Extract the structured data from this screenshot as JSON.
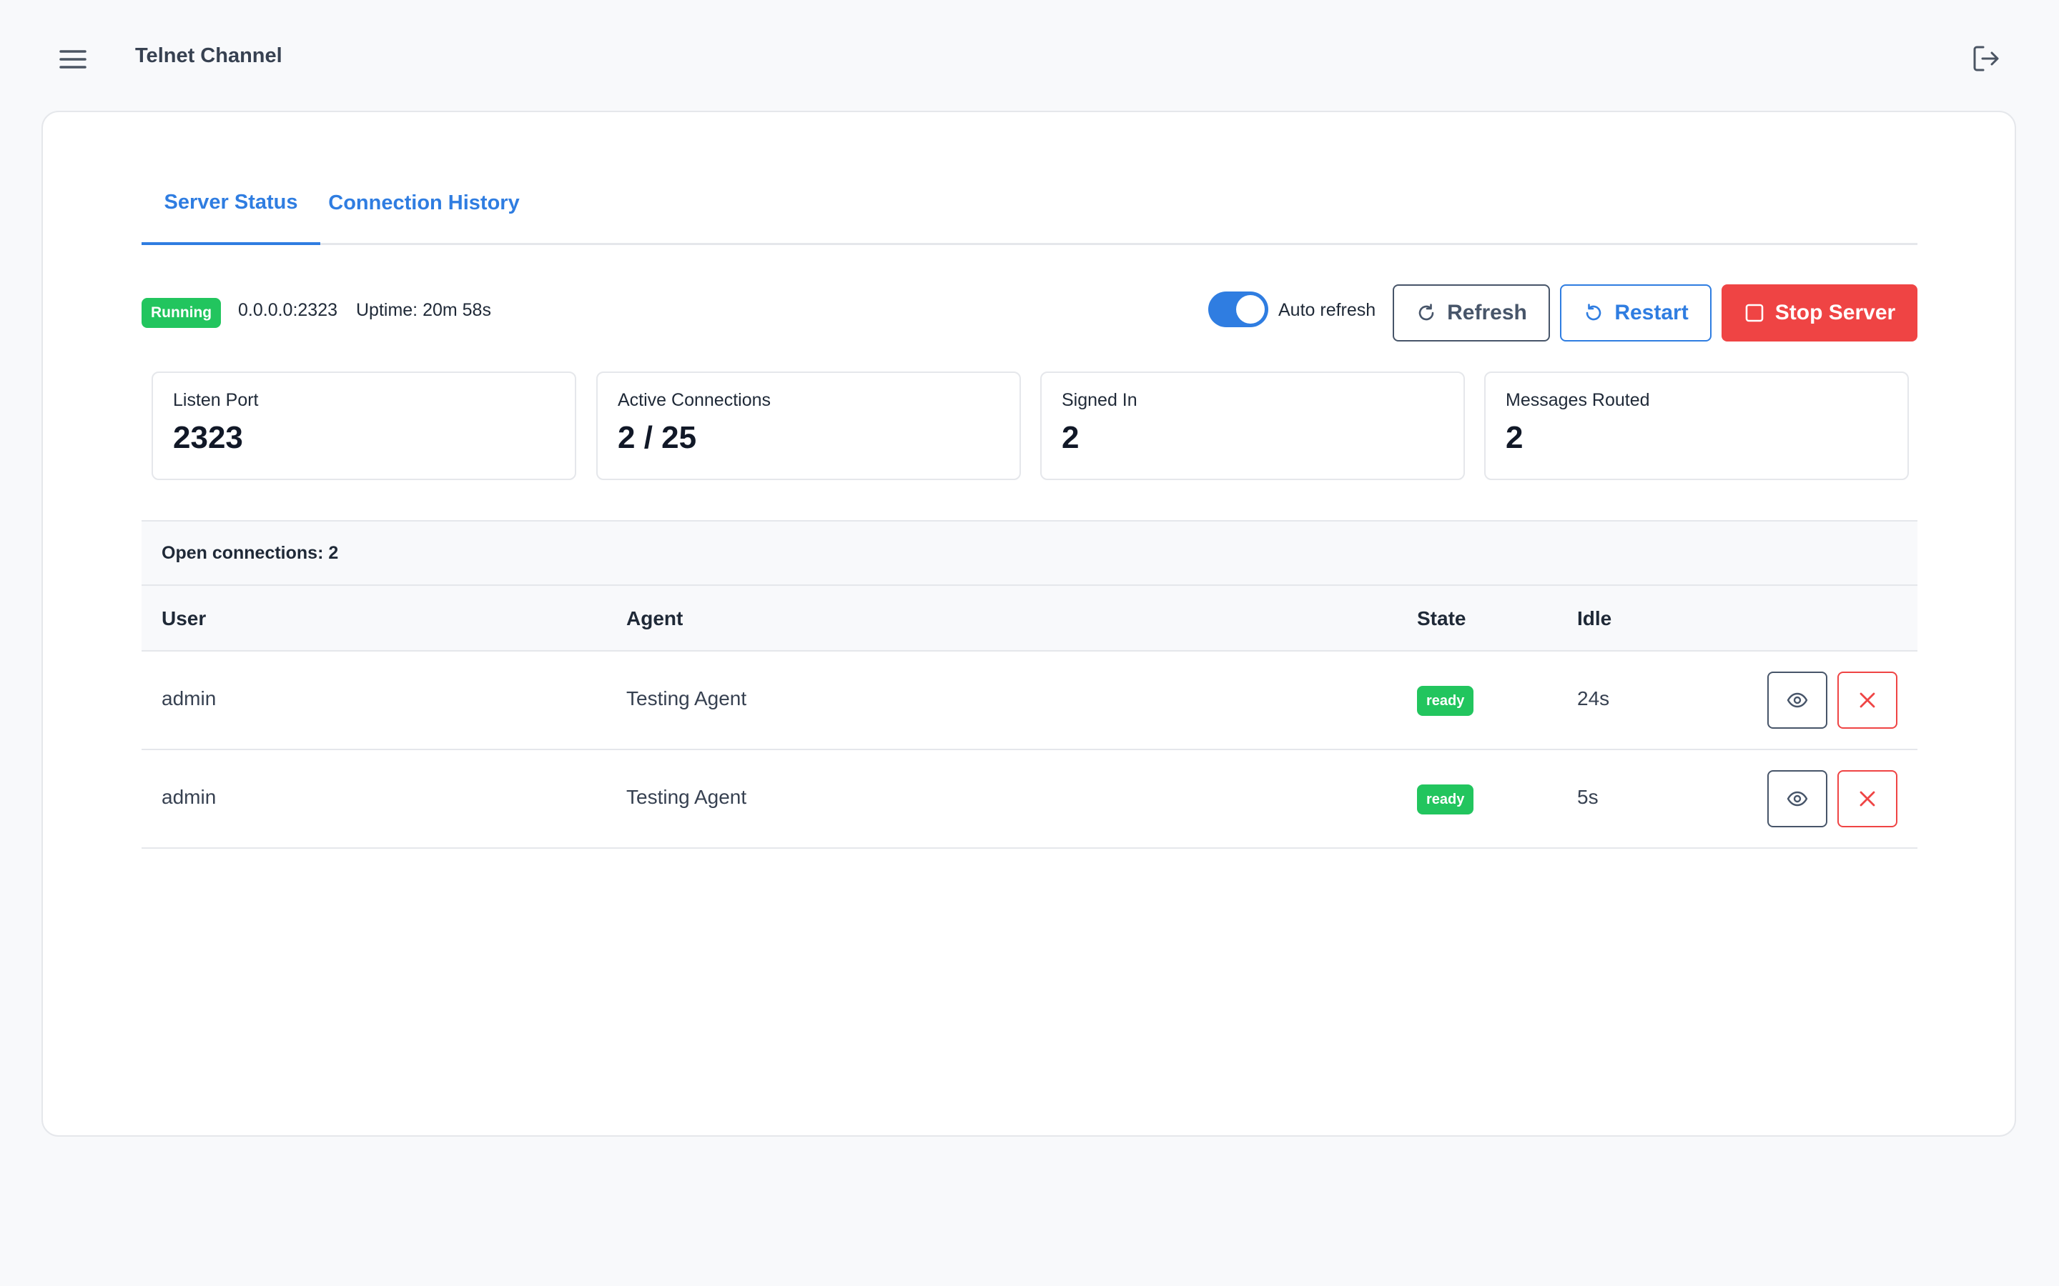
{
  "header": {
    "title": "Telnet Channel"
  },
  "tabs": [
    {
      "label": "Server Status"
    },
    {
      "label": "Connection History"
    }
  ],
  "status": {
    "badge": "Running",
    "address": "0.0.0.0:2323",
    "uptime": "Uptime: 20m 58s",
    "auto_refresh_label": "Auto refresh",
    "auto_refresh_on": true
  },
  "actions": {
    "refresh": "Refresh",
    "restart": "Restart",
    "stop": "Stop Server"
  },
  "stats": [
    {
      "label": "Listen Port",
      "value": "2323"
    },
    {
      "label": "Active Connections",
      "value": "2 / 25"
    },
    {
      "label": "Signed In",
      "value": "2"
    },
    {
      "label": "Messages Routed",
      "value": "2"
    }
  ],
  "table": {
    "caption": "Open connections: 2",
    "columns": [
      "User",
      "Agent",
      "State",
      "Idle"
    ],
    "rows": [
      {
        "user": "admin",
        "agent": "Testing Agent",
        "state": "ready",
        "idle": "24s"
      },
      {
        "user": "admin",
        "agent": "Testing Agent",
        "state": "ready",
        "idle": "5s"
      }
    ]
  },
  "colors": {
    "accent": "#2f7de1",
    "success": "#22c55e",
    "danger": "#ef4444",
    "neutral": "#475569"
  },
  "icons": [
    "menu-icon",
    "logout-icon",
    "refresh-icon",
    "restart-icon",
    "stop-icon",
    "eye-icon",
    "close-icon"
  ]
}
